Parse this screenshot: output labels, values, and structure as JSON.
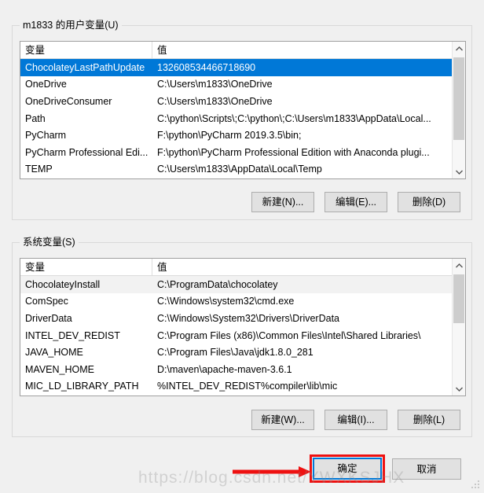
{
  "user_group": {
    "legend": "m1833 的用户变量(U)",
    "columns": [
      "变量",
      "值"
    ],
    "rows": [
      {
        "name": "ChocolateyLastPathUpdate",
        "value": "132608534466718690",
        "selected": true
      },
      {
        "name": "OneDrive",
        "value": "C:\\Users\\m1833\\OneDrive",
        "selected": false
      },
      {
        "name": "OneDriveConsumer",
        "value": "C:\\Users\\m1833\\OneDrive",
        "selected": false
      },
      {
        "name": "Path",
        "value": "C:\\python\\Scripts\\;C:\\python\\;C:\\Users\\m1833\\AppData\\Local...",
        "selected": false
      },
      {
        "name": "PyCharm",
        "value": "F:\\python\\PyCharm 2019.3.5\\bin;",
        "selected": false
      },
      {
        "name": "PyCharm Professional Edi...",
        "value": "F:\\python\\PyCharm Professional Edition with Anaconda plugi...",
        "selected": false
      },
      {
        "name": "TEMP",
        "value": "C:\\Users\\m1833\\AppData\\Local\\Temp",
        "selected": false
      }
    ],
    "buttons": {
      "new": "新建(N)...",
      "edit": "编辑(E)...",
      "delete": "删除(D)"
    },
    "scrollbar": {
      "up": "⌃",
      "down": "⌄"
    }
  },
  "system_group": {
    "legend": "系统变量(S)",
    "columns": [
      "变量",
      "值"
    ],
    "rows": [
      {
        "name": "ChocolateyInstall",
        "value": "C:\\ProgramData\\chocolatey",
        "soft": true
      },
      {
        "name": "ComSpec",
        "value": "C:\\Windows\\system32\\cmd.exe",
        "soft": false
      },
      {
        "name": "DriverData",
        "value": "C:\\Windows\\System32\\Drivers\\DriverData",
        "soft": false
      },
      {
        "name": "INTEL_DEV_REDIST",
        "value": "C:\\Program Files (x86)\\Common Files\\Intel\\Shared Libraries\\",
        "soft": false
      },
      {
        "name": "JAVA_HOME",
        "value": "C:\\Program Files\\Java\\jdk1.8.0_281",
        "soft": false
      },
      {
        "name": "MAVEN_HOME",
        "value": "D:\\maven\\apache-maven-3.6.1",
        "soft": false
      },
      {
        "name": "MIC_LD_LIBRARY_PATH",
        "value": "%INTEL_DEV_REDIST%compiler\\lib\\mic",
        "soft": false
      }
    ],
    "buttons": {
      "new": "新建(W)...",
      "edit": "编辑(I)...",
      "delete": "删除(L)"
    },
    "scrollbar": {
      "up": "⌃",
      "down": "⌄"
    }
  },
  "dialog_buttons": {
    "ok": "确定",
    "cancel": "取消"
  },
  "annotations": {
    "watermark": "https://blog.csdn.net/YWXKSJHX",
    "highlight_color": "#ee1111",
    "arrow_color": "#ee1111",
    "focus_color": "#0078d7"
  },
  "colors": {
    "selection": "#0078d7",
    "window_bg": "#f0f0f0",
    "list_bg": "#ffffff",
    "button_bg": "#e1e1e1"
  }
}
